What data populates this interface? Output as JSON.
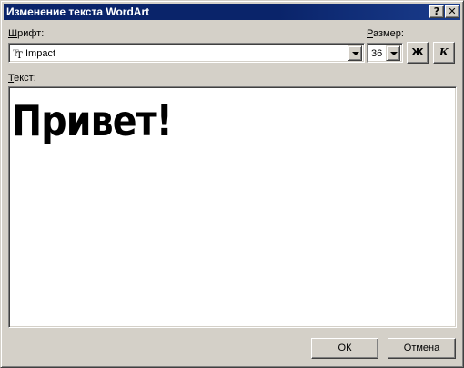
{
  "dialog": {
    "title": "Изменение текста WordArt",
    "help_glyph": "?",
    "close_glyph": "✕"
  },
  "font": {
    "label": "Шрифт:",
    "label_access_key": "Ш",
    "label_rest": "рифт:",
    "value": "Impact",
    "icon": "truetype-icon"
  },
  "size": {
    "label": "Размер:",
    "label_access_key": "Р",
    "label_rest": "азмер:",
    "value": "36"
  },
  "style_buttons": {
    "bold": "Ж",
    "italic": "К"
  },
  "text": {
    "label": "Текст:",
    "label_access_key": "Т",
    "label_rest": "екст:",
    "value": "Привет!"
  },
  "buttons": {
    "ok": "ОК",
    "cancel": "Отмена"
  }
}
